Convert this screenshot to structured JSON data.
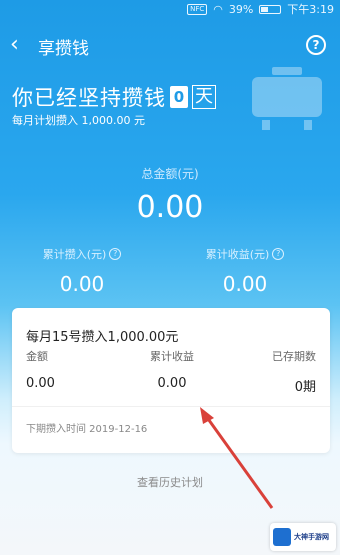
{
  "status_bar": {
    "nfc": "NFC",
    "battery": "39%",
    "battery_level": 0.39,
    "time": "下午3:19"
  },
  "header": {
    "title": "享攒钱",
    "help_symbol": "?"
  },
  "hero": {
    "headline": "你已经坚持攒钱",
    "days": "0",
    "day_unit": "天",
    "monthly_plan": "每月计划攒入 1,000.00 元"
  },
  "totals": {
    "total_label": "总金额(元)",
    "total_value": "0.00",
    "deposited_label": "累计攒入(元)",
    "deposited_value": "0.00",
    "earnings_label": "累计收益(元)",
    "earnings_value": "0.00"
  },
  "plan_card": {
    "title": "每月15号攒入1,000.00元",
    "col_amount_label": "金额",
    "col_amount_value": "0.00",
    "col_earnings_label": "累计收益",
    "col_earnings_value": "0.00",
    "col_periods_label": "已存期数",
    "col_periods_value": "0期",
    "next_deposit": "下期攒入时间 2019-12-16"
  },
  "history_link": "查看历史计划",
  "colors": {
    "primary_blue": "#1e9be6",
    "annotation_arrow": "#d9413a"
  },
  "watermark": {
    "line1": "大神手游网"
  }
}
